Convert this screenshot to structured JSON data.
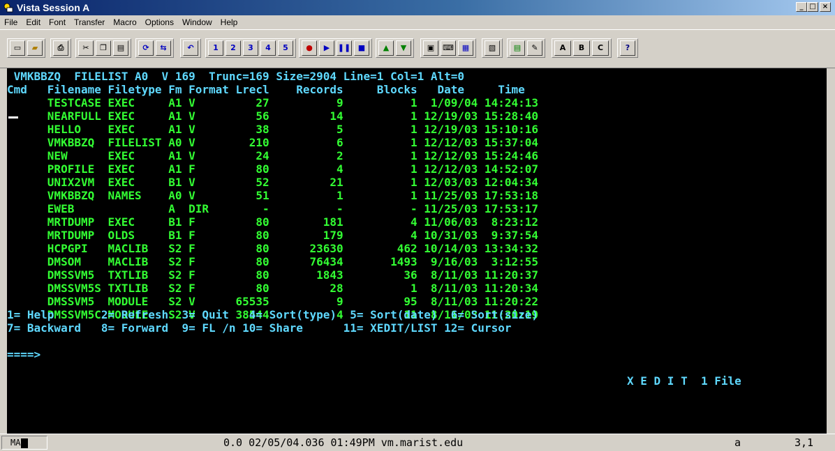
{
  "window": {
    "title": "Vista Session A",
    "minimize": "_",
    "maximize": "□",
    "close": "×"
  },
  "menu": [
    "File",
    "Edit",
    "Font",
    "Transfer",
    "Macro",
    "Options",
    "Window",
    "Help"
  ],
  "toolbar": {
    "icons": [
      "new-document-icon",
      "open-folder-icon",
      "print-icon",
      "cut-icon",
      "copy-icon",
      "paste-icon",
      "sync-icon",
      "transfer-icon",
      "undo-icon",
      "pf1-icon",
      "pf2-icon",
      "pf3-icon",
      "pf4-icon",
      "pf5-icon",
      "record-macro-icon",
      "play-macro-icon",
      "pause-macro-icon",
      "stop-macro-icon",
      "upload-icon",
      "download-icon",
      "session-icon",
      "keyboard-icon",
      "map-icon",
      "clipboard-icon",
      "screen-icon",
      "notepad-icon",
      "help-icon"
    ],
    "pf_labels": [
      "1",
      "2",
      "3",
      "4",
      "5"
    ],
    "abc_labels": [
      "A",
      "B",
      "C"
    ],
    "help_label": "?"
  },
  "terminal": {
    "header1": " VMKBBZQ  FILELIST A0  V 169  Trunc=169 Size=2904 Line=1 Col=1 Alt=0",
    "header2": "Cmd   Filename Filetype Fm Format Lrecl    Records     Blocks   Date     Time",
    "rows": [
      "      TESTCASE EXEC     A1 V         27          9          1  1/09/04 14:24:13",
      "      NEARFULL EXEC     A1 V         56         14          1 12/19/03 15:28:40",
      "      HELLO    EXEC     A1 V         38          5          1 12/19/03 15:10:16",
      "      VMKBBZQ  FILELIST A0 V        210          6          1 12/12/03 15:37:04",
      "      NEW      EXEC     A1 V         24          2          1 12/12/03 15:24:46",
      "      PROFILE  EXEC     A1 F         80          4          1 12/12/03 14:52:07",
      "      UNIX2VM  EXEC     B1 V         52         21          1 12/03/03 12:04:34",
      "      VMKBBZQ  NAMES    A0 V         51          1          1 11/25/03 17:53:18",
      "      EWEB              A  DIR        -          -          - 11/25/03 17:53:17",
      "      MRTDUMP  EXEC     B1 F         80        181          4 11/06/03  8:23:12",
      "      MRTDUMP  OLDS     B1 F         80        179          4 10/31/03  9:37:54",
      "      HCPGPI   MACLIB   S2 F         80      23630        462 10/14/03 13:34:32",
      "      DMSOM    MACLIB   S2 F         80      76434       1493  9/16/03  3:12:55",
      "      DMSSVM5  TXTLIB   S2 F         80       1843         36  8/11/03 11:20:37",
      "      DMSSVM5S TXTLIB   S2 F         80         28          1  8/11/03 11:20:34",
      "      DMSSVM5  MODULE   S2 V      65535          9         95  8/11/03 11:20:22",
      "      DMSSVM5C MODULE   S2 V      38544          4         11  8/11/03 11:20:19"
    ],
    "pf1": "1= Help       2= Refresh  3= Quit   4= Sort(type)  5= Sort(date)  6= Sort(size)",
    "pf2": "7= Backward   8= Forward  9= FL /n 10= Share      11= XEDIT/LIST 12= Cursor",
    "cmdline": "====>",
    "mode": "X E D I T  1 File"
  },
  "status": {
    "indicator": "MA",
    "info": "0.0 02/05/04.036 01:49PM vm.marist.edu",
    "session": "a",
    "cursor_pos": "3,1"
  }
}
